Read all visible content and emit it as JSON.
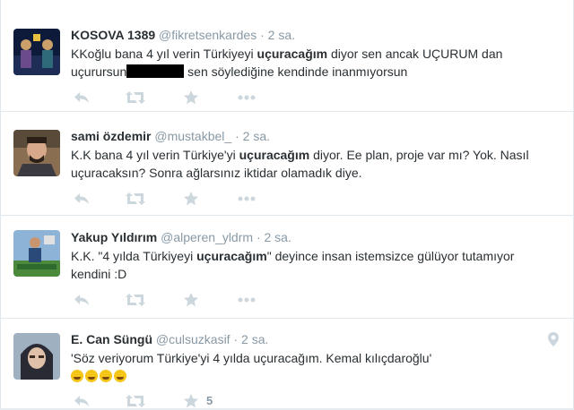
{
  "tweets": [
    {
      "name": "KOSOVA 1389",
      "handle": "@fikretsenkardes",
      "time": "2 sa.",
      "text_parts": [
        "KKoğlu bana 4 yıl verin Türkiyeyi ",
        "uçuracağım",
        " diyor sen ancak UÇURUM dan uçurursun",
        "",
        " sen söylediğine kendinde inanmıyorsun"
      ]
    },
    {
      "name": "sami özdemir",
      "handle": "@mustakbel_",
      "time": "2 sa.",
      "text_parts": [
        "K.K bana 4 yıl verin Türkiye'yi ",
        "uçuracağım",
        " diyor. Ee plan, proje var mı? Yok. Nasıl uçuracaksın? Sonra ağlarsınız iktidar olamadık diye."
      ]
    },
    {
      "name": "Yakup Yıldırım",
      "handle": "@alperen_yldrm",
      "time": "2 sa.",
      "text_parts": [
        "K.K. \"4 yılda Türkiyeyi ",
        "uçuracağım",
        "\" deyince insan istemsizce gülüyor tutamıyor kendini :D"
      ]
    },
    {
      "name": "E. Can Süngü",
      "handle": "@culsuzkasif",
      "time": "2 sa.",
      "text": "'Söz veriyorum Türkiye'yi 4 yılda uçuracağım. Kemal kılıçdaroğlu'",
      "emoji_count": 4,
      "favorite_count": "5"
    }
  ],
  "separator": "·",
  "icons": [
    "reply-icon",
    "retweet-icon",
    "favorite-icon",
    "more-icon",
    "location-pin-icon"
  ],
  "colors": {
    "icon": "#ccd6dd",
    "meta": "#8899a6",
    "text": "#292f33",
    "emoji": "#f5c518"
  }
}
